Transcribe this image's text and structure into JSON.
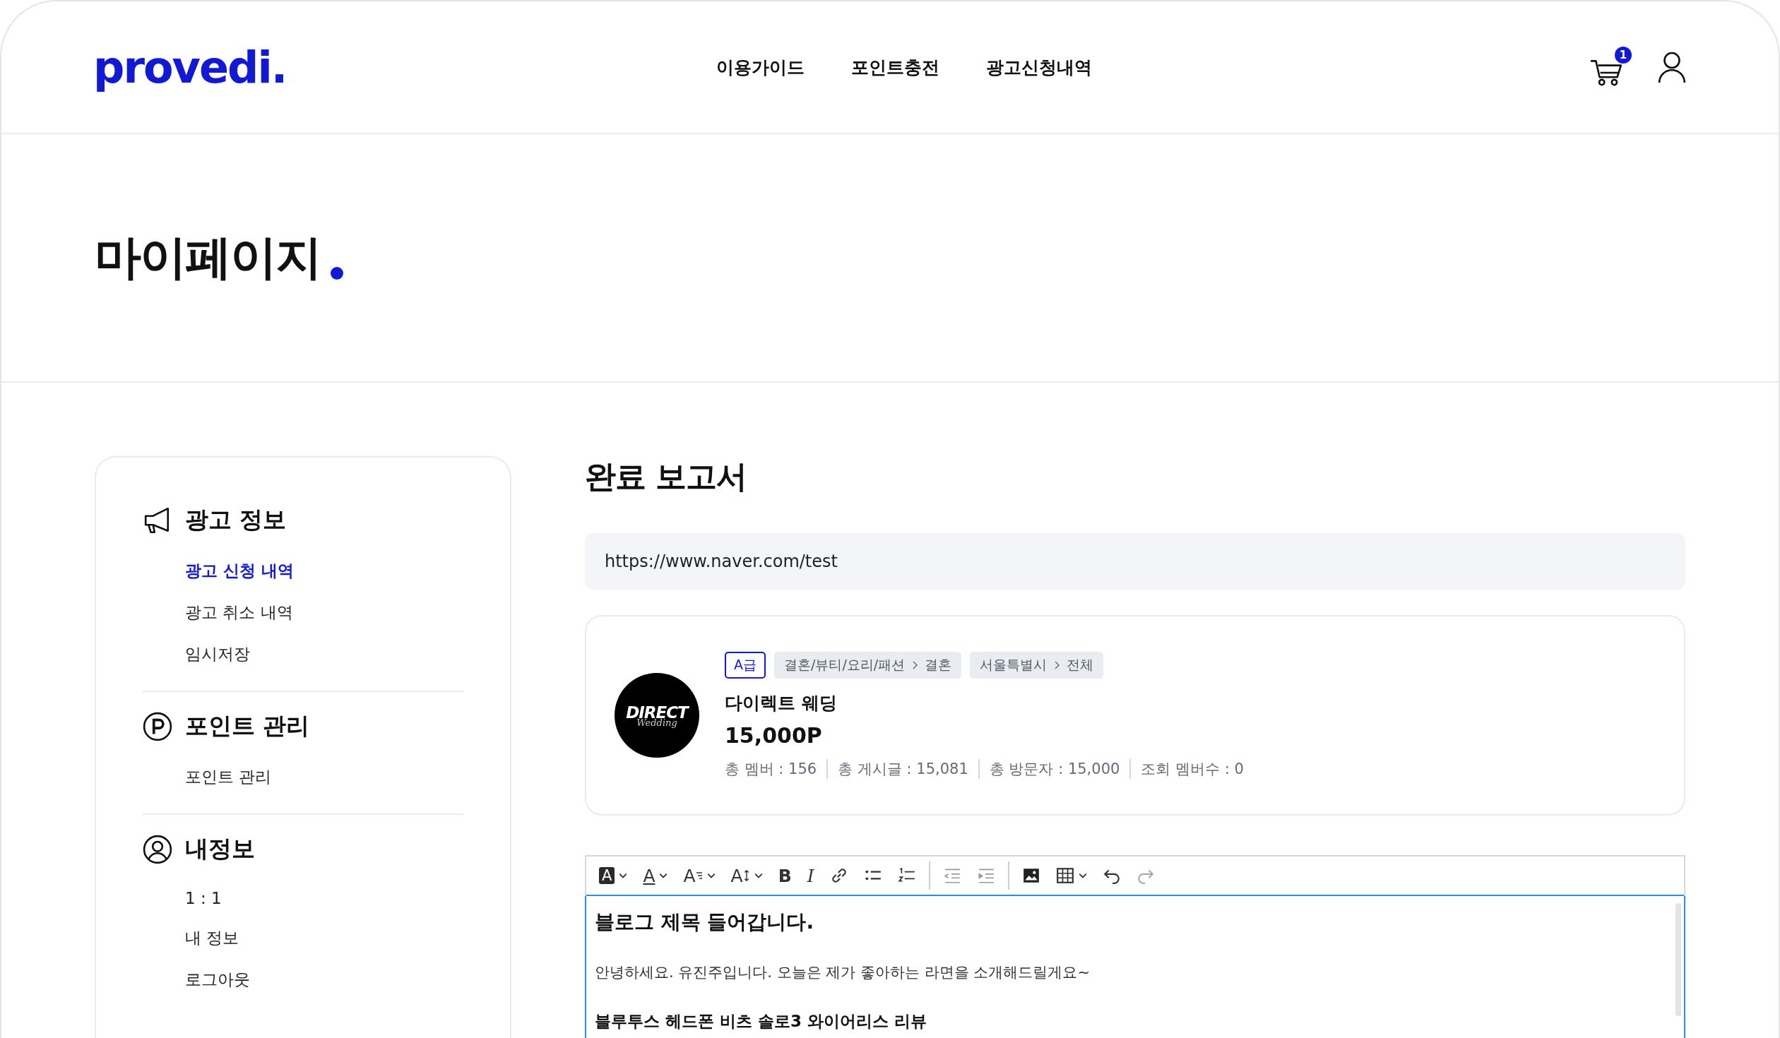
{
  "header": {
    "logo": "provedi.",
    "nav": [
      {
        "label": "이용가이드",
        "selected": false
      },
      {
        "label": "포인트충전",
        "selected": false
      },
      {
        "label": "광고신청내역",
        "selected": false
      }
    ],
    "cart_count": "1"
  },
  "hero": {
    "title": "마이페이지"
  },
  "sidebar": {
    "sections": [
      {
        "kind": "ad",
        "title": "광고 정보",
        "items": [
          {
            "label": "광고 신청 내역",
            "selected": true
          },
          {
            "label": "광고 취소 내역",
            "selected": false
          },
          {
            "label": "임시저장",
            "selected": false
          }
        ]
      },
      {
        "kind": "point",
        "title": "포인트 관리",
        "items": [
          {
            "label": "포인트 관리",
            "selected": false
          }
        ]
      },
      {
        "kind": "user",
        "title": "내정보",
        "items": [
          {
            "label": "1 : 1",
            "selected": false
          },
          {
            "label": "내 정보",
            "selected": false
          },
          {
            "label": "로그아웃",
            "selected": false
          }
        ]
      }
    ]
  },
  "report": {
    "title": "완료 보고서",
    "url": "https://www.naver.com/test",
    "card": {
      "logo_text": "DIRECT",
      "logo_script": "Wedding",
      "grade": "A급",
      "tags": [
        {
          "path": [
            "결혼/뷰티/요리/패션",
            "결혼"
          ]
        },
        {
          "path": [
            "서울특별시",
            "전체"
          ]
        }
      ],
      "name": "다이렉트 웨딩",
      "price": "15,000P",
      "stats": [
        "총 멤버 : 156",
        "총 게시글 : 15,081",
        "총 방문자 : 15,000",
        "조회 멤버수 :  0"
      ]
    },
    "editor": {
      "toolbar": [
        [
          {
            "kind": "highlight",
            "glyph": "A",
            "dropdown": true
          },
          {
            "kind": "color",
            "glyph": "A",
            "dropdown": true
          },
          {
            "kind": "format",
            "glyph": "A",
            "dropdown": true
          },
          {
            "kind": "size",
            "glyph": "A",
            "dropdown": true
          },
          {
            "kind": "bold",
            "glyph": "B",
            "dropdown": false
          },
          {
            "kind": "italic",
            "glyph": "I",
            "dropdown": false
          },
          {
            "kind": "link",
            "dropdown": false
          },
          {
            "kind": "bullets",
            "dropdown": false
          },
          {
            "kind": "numbers",
            "dropdown": false
          }
        ],
        [
          {
            "kind": "outdent",
            "dropdown": false
          },
          {
            "kind": "indent",
            "dropdown": false
          }
        ],
        [
          {
            "kind": "image",
            "dropdown": false
          },
          {
            "kind": "table",
            "dropdown": true
          },
          {
            "kind": "undo",
            "dropdown": false
          },
          {
            "kind": "redo",
            "dropdown": false
          }
        ]
      ],
      "content": [
        {
          "kind": "heading",
          "text": "블로그 제목 들어갑니다."
        },
        {
          "kind": "paragraph",
          "text": "안녕하세요. 유진주입니다. 오늘은 제가 좋아하는 라면을 소개해드릴게요~"
        },
        {
          "kind": "subheading",
          "text": "블루투스 헤드폰 비츠 솔로3 와이어리스 리뷰"
        }
      ]
    }
  }
}
